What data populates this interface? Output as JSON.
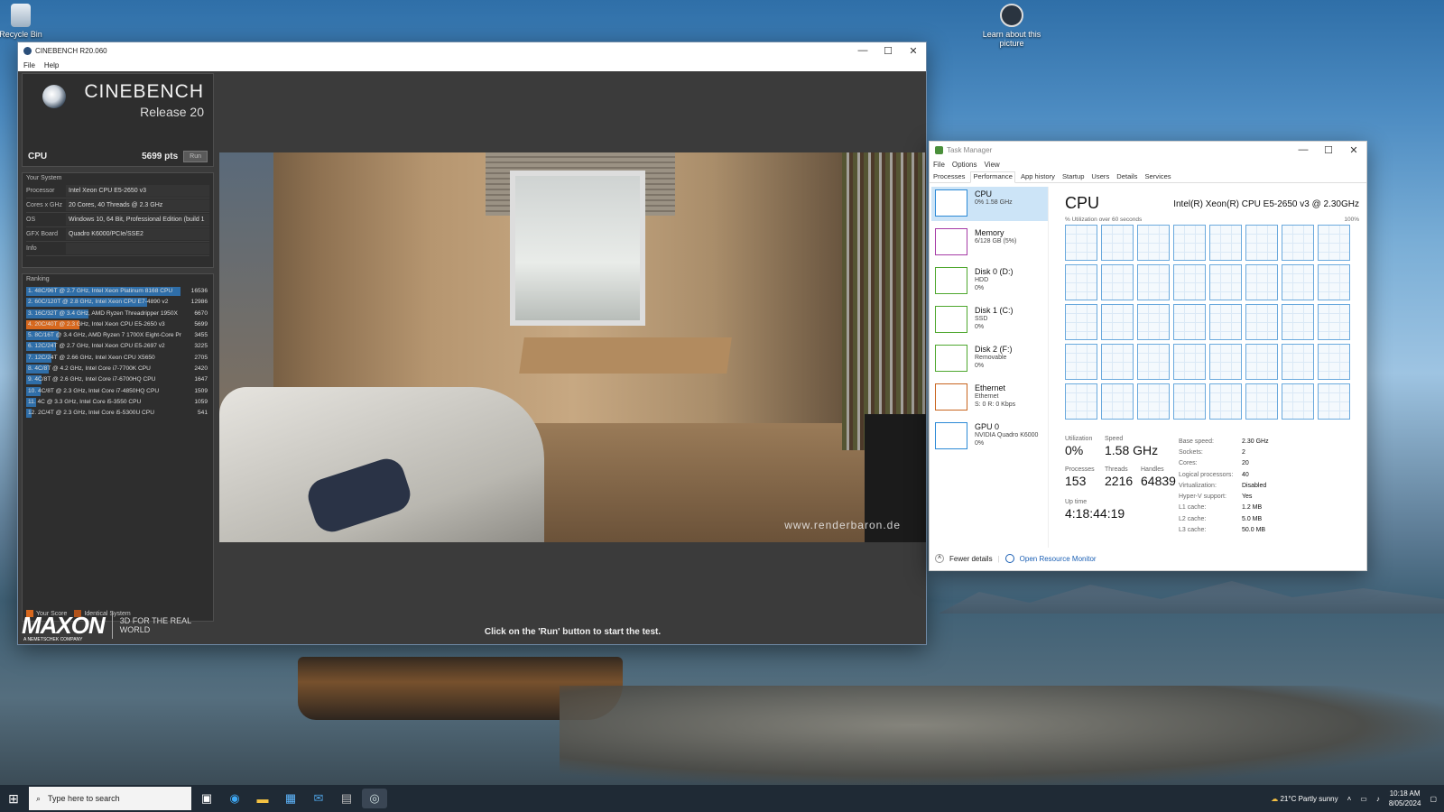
{
  "desktop": {
    "icons": [
      {
        "label": "Recycle Bin",
        "name": "recycle-bin-icon"
      },
      {
        "label": "Learn about this picture",
        "name": "learn-about-picture-icon"
      }
    ]
  },
  "cinebench": {
    "window_title": "CINEBENCH R20.060",
    "menu": [
      "File",
      "Help"
    ],
    "logo_title": "CINEBENCH",
    "logo_subtitle": "Release 20",
    "score_label": "CPU",
    "score_value": "5699 pts",
    "run_label": "Run",
    "system_header": "Your System",
    "system": [
      {
        "key": "Processor",
        "value": "Intel Xeon CPU E5-2650 v3"
      },
      {
        "key": "Cores x GHz",
        "value": "20 Cores, 40 Threads @ 2.3 GHz"
      },
      {
        "key": "OS",
        "value": "Windows 10, 64 Bit, Professional Edition (build 1"
      },
      {
        "key": "GFX Board",
        "value": "Quadro K6000/PCIe/SSE2"
      },
      {
        "key": "Info",
        "value": ""
      }
    ],
    "ranking_header": "Ranking",
    "ranking": [
      {
        "label": "1. 48C/96T @ 2.7 GHz, Intel Xeon Platinum 8168 CPU",
        "score": "16536",
        "value": 16536,
        "mine": false
      },
      {
        "label": "2. 60C/120T @ 2.8 GHz, Intel Xeon CPU E7-4890 v2",
        "score": "12986",
        "value": 12986,
        "mine": false
      },
      {
        "label": "3. 16C/32T @ 3.4 GHz, AMD Ryzen Threadripper 1950X",
        "score": "6670",
        "value": 6670,
        "mine": false
      },
      {
        "label": "4. 20C/40T @ 2.3 GHz, Intel Xeon CPU E5-2650 v3",
        "score": "5699",
        "value": 5699,
        "mine": true
      },
      {
        "label": "5. 8C/16T @ 3.4 GHz, AMD Ryzen 7 1700X Eight-Core Pr",
        "score": "3455",
        "value": 3455,
        "mine": false
      },
      {
        "label": "6. 12C/24T @ 2.7 GHz, Intel Xeon CPU E5-2697 v2",
        "score": "3225",
        "value": 3225,
        "mine": false
      },
      {
        "label": "7. 12C/24T @ 2.66 GHz, Intel Xeon CPU X5650",
        "score": "2705",
        "value": 2705,
        "mine": false
      },
      {
        "label": "8. 4C/8T @ 4.2 GHz, Intel Core i7-7700K CPU",
        "score": "2420",
        "value": 2420,
        "mine": false
      },
      {
        "label": "9. 4C/8T @ 2.6 GHz, Intel Core i7-6700HQ CPU",
        "score": "1647",
        "value": 1647,
        "mine": false
      },
      {
        "label": "10. 4C/8T @ 2.3 GHz, Intel Core i7-4850HQ CPU",
        "score": "1509",
        "value": 1509,
        "mine": false
      },
      {
        "label": "11. 4C @ 3.3 GHz, Intel Core i5-3550 CPU",
        "score": "1059",
        "value": 1059,
        "mine": false
      },
      {
        "label": "12. 2C/4T @ 2.3 GHz, Intel Core i5-5300U CPU",
        "score": "541",
        "value": 541,
        "mine": false
      }
    ],
    "legend": [
      "Your Score",
      "Identical System"
    ],
    "colors": {
      "bar": "#2f6ea8",
      "mine": "#d7681e"
    },
    "brand": "MAXON",
    "brand_sub": "A NEMETSCHEK COMPANY",
    "tagline": "3D FOR THE REAL WORLD",
    "watermark": "www.renderbaron.de",
    "status": "Click on the 'Run' button to start the test."
  },
  "taskmanager": {
    "window_title": "Task Manager",
    "menu": [
      "File",
      "Options",
      "View"
    ],
    "tabs": [
      "Processes",
      "Performance",
      "App history",
      "Startup",
      "Users",
      "Details",
      "Services"
    ],
    "active_tab": "Performance",
    "sidebar": [
      {
        "name": "CPU",
        "s1": "0% 1.58 GHz",
        "s2": "",
        "color": "#2b89d6",
        "selected": true
      },
      {
        "name": "Memory",
        "s1": "6/128 GB (5%)",
        "s2": "",
        "color": "#a63ba6",
        "selected": false
      },
      {
        "name": "Disk 0 (D:)",
        "s1": "HDD",
        "s2": "0%",
        "color": "#4ea72e",
        "selected": false
      },
      {
        "name": "Disk 1 (C:)",
        "s1": "SSD",
        "s2": "0%",
        "color": "#4ea72e",
        "selected": false
      },
      {
        "name": "Disk 2 (F:)",
        "s1": "Removable",
        "s2": "0%",
        "color": "#4ea72e",
        "selected": false
      },
      {
        "name": "Ethernet",
        "s1": "Ethernet",
        "s2": "S: 0 R: 0 Kbps",
        "color": "#c8641e",
        "selected": false
      },
      {
        "name": "GPU 0",
        "s1": "NVIDIA Quadro K6000",
        "s2": "0%",
        "color": "#2b89d6",
        "selected": false
      }
    ],
    "detail_title": "CPU",
    "model": "Intel(R) Xeon(R) CPU E5-2650 v3 @ 2.30GHz",
    "util_caption": "% Utilization over 60 seconds",
    "util_max": "100%",
    "stats": {
      "utilization_label": "Utilization",
      "utilization": "0%",
      "speed_label": "Speed",
      "speed": "1.58 GHz",
      "processes_label": "Processes",
      "processes": "153",
      "threads_label": "Threads",
      "threads": "2216",
      "handles_label": "Handles",
      "handles": "64839",
      "uptime_label": "Up time",
      "uptime": "4:18:44:19"
    },
    "specs": [
      {
        "k": "Base speed:",
        "v": "2.30 GHz"
      },
      {
        "k": "Sockets:",
        "v": "2"
      },
      {
        "k": "Cores:",
        "v": "20"
      },
      {
        "k": "Logical processors:",
        "v": "40"
      },
      {
        "k": "Virtualization:",
        "v": "Disabled"
      },
      {
        "k": "Hyper-V support:",
        "v": "Yes"
      },
      {
        "k": "L1 cache:",
        "v": "1.2 MB"
      },
      {
        "k": "L2 cache:",
        "v": "5.0 MB"
      },
      {
        "k": "L3 cache:",
        "v": "50.0 MB"
      }
    ],
    "fewer_details": "Fewer details",
    "open_resource_monitor": "Open Resource Monitor"
  },
  "taskbar": {
    "search_placeholder": "Type here to search",
    "weather": "21°C  Partly sunny",
    "time": "10:18 AM",
    "date": "8/05/2024"
  }
}
